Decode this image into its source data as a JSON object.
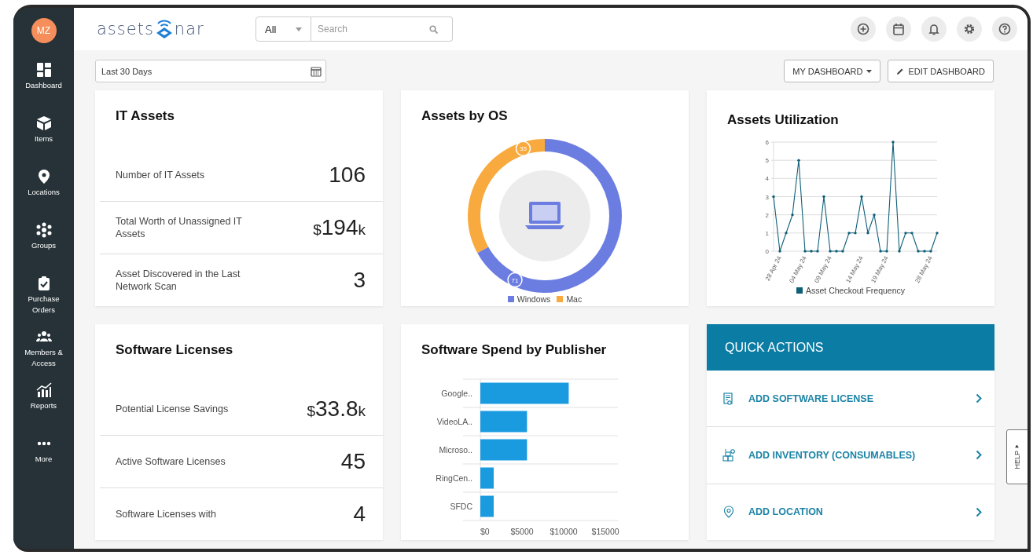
{
  "sidebar": {
    "avatar": "MZ",
    "items": [
      {
        "label": "Dashboard"
      },
      {
        "label": "Items"
      },
      {
        "label": "Locations"
      },
      {
        "label": "Groups"
      },
      {
        "label": "Purchase Orders"
      },
      {
        "label": "Members & Access"
      },
      {
        "label": "Reports"
      },
      {
        "label": "More"
      }
    ]
  },
  "topbar": {
    "logo": {
      "left": "assets",
      "right": "nar"
    },
    "search": {
      "scope": "All",
      "placeholder": "Search"
    }
  },
  "toolbar": {
    "date_range": "Last 30 Days",
    "buttons": [
      {
        "label": "MY DASHBOARD",
        "kind": "dropdown"
      },
      {
        "label": "EDIT DASHBOARD",
        "kind": "edit"
      }
    ]
  },
  "widgets": [
    {
      "kind": "stats",
      "title": "IT Assets",
      "rows": [
        {
          "label": "Number of IT Assets",
          "value": "106"
        },
        {
          "label": "Total Worth of Unassigned IT Assets",
          "prefix": "$",
          "value": "194",
          "suffix": "k"
        },
        {
          "label": "Asset Discovered in the Last Network Scan",
          "value": "3"
        }
      ]
    },
    {
      "kind": "chart",
      "title": "Assets by OS",
      "chart_data": {
        "type": "donut",
        "data_labels": true,
        "categories": [
          "Windows",
          "Mac"
        ],
        "colors": [
          "#6c7de2",
          "#f8aa3e"
        ],
        "series": [
          {
            "values": [
              71,
              35
            ]
          }
        ]
      }
    },
    {
      "kind": "chart",
      "title": "Assets Utilization",
      "chart_data": {
        "type": "line",
        "categories": [
          null,
          "28 Apr 24",
          null,
          null,
          null,
          "04 May 24",
          null,
          null,
          null,
          "09 May 24",
          null,
          null,
          null,
          null,
          "14 May 24",
          null,
          null,
          null,
          "19 May 24",
          null,
          null,
          null,
          null,
          null,
          null,
          "28 May 24",
          null
        ],
        "ylim": [
          0,
          6
        ],
        "yticks": [
          0,
          1,
          2,
          3,
          4,
          5,
          6
        ],
        "grid": true,
        "series": [
          {
            "name": "Asset Checkout Frequency",
            "color": "#0e5f78",
            "values": [
              3,
              0,
              1,
              2,
              5,
              0,
              0,
              0,
              3,
              0,
              0,
              0,
              1,
              1,
              3,
              1,
              2,
              0,
              0,
              6,
              0,
              1,
              1,
              0,
              0,
              0,
              1
            ]
          }
        ]
      }
    },
    {
      "kind": "stats",
      "title": "Software Licenses",
      "rows": [
        {
          "label": "Potential License Savings",
          "prefix": "$",
          "value": "33.8",
          "suffix": "k"
        },
        {
          "label": "Active Software Licenses",
          "value": "45"
        },
        {
          "label": "Software Licenses with",
          "value": "4"
        }
      ]
    },
    {
      "kind": "chart",
      "title": "Software Spend by Publisher",
      "chart_data": {
        "type": "bar",
        "orientation": "horizontal",
        "categories": [
          "Google..",
          "VideoLA..",
          "Microso..",
          "RingCen..",
          "SFDC"
        ],
        "xlim": [
          0,
          16500
        ],
        "xticks": [
          {
            "value": 0,
            "label": "$0"
          },
          {
            "value": 5000,
            "label": "$5000"
          },
          {
            "value": 10000,
            "label": "$10000"
          },
          {
            "value": 15000,
            "label": "$15000"
          }
        ],
        "series": [
          {
            "color": "#1a9be0",
            "values": [
              10600,
              5600,
              5600,
              1600,
              1600
            ]
          }
        ]
      }
    },
    {
      "kind": "actions",
      "title": "QUICK ACTIONS",
      "items": [
        {
          "label": "ADD SOFTWARE LICENSE"
        },
        {
          "label": "ADD INVENTORY (CONSUMABLES)"
        },
        {
          "label": "ADD LOCATION"
        }
      ]
    }
  ],
  "help_tab": "HELP"
}
